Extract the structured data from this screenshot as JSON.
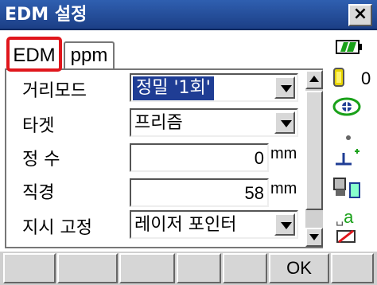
{
  "window": {
    "title": "EDM 설정",
    "close_label": "×"
  },
  "tabs": [
    {
      "label": "EDM",
      "active": true
    },
    {
      "label": "ppm",
      "active": false
    }
  ],
  "form": {
    "distance_mode": {
      "label": "거리모드",
      "value": "정밀 '1회'"
    },
    "target": {
      "label": "타겟",
      "value": "프리즘"
    },
    "constant": {
      "label": "정 수",
      "value": "0",
      "unit": "mm"
    },
    "diameter": {
      "label": "직경",
      "value": "58",
      "unit": "mm"
    },
    "indicator": {
      "label": "지시 고정",
      "value": "레이저 포인터"
    }
  },
  "status": {
    "battery_icon": "battery-icon",
    "prism_constant_value": "0",
    "accent_green": "#1aa11a",
    "text_label": "a"
  },
  "softkeys": [
    "",
    "",
    "",
    "",
    "",
    "OK",
    ""
  ]
}
